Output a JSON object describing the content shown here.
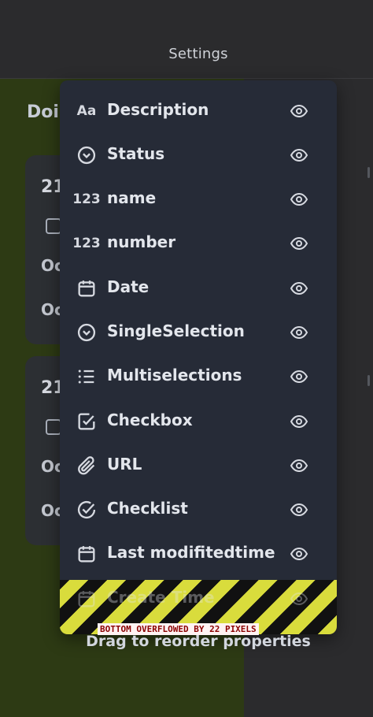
{
  "header": {
    "title": "Settings"
  },
  "board": {
    "column_title": "Doi",
    "cards": [
      {
        "number": "21",
        "line1": "Oc",
        "line2": "Oc"
      },
      {
        "number": "21",
        "line1": "Oc",
        "line2": "Oc"
      }
    ]
  },
  "properties": {
    "items": [
      {
        "label": "Description",
        "icon": "text-aa-icon",
        "icon_text": "Aa",
        "visible_icon": "eye-icon"
      },
      {
        "label": "Status",
        "icon": "chevron-circle-icon",
        "visible_icon": "eye-icon"
      },
      {
        "label": "name",
        "icon": "number-icon",
        "icon_text": "123",
        "visible_icon": "eye-icon"
      },
      {
        "label": "number",
        "icon": "number-icon",
        "icon_text": "123",
        "visible_icon": "eye-icon"
      },
      {
        "label": "Date",
        "icon": "calendar-icon",
        "visible_icon": "eye-icon"
      },
      {
        "label": "SingleSelection",
        "icon": "chevron-circle-icon",
        "visible_icon": "eye-icon"
      },
      {
        "label": "Multiselections",
        "icon": "list-icon",
        "visible_icon": "eye-icon"
      },
      {
        "label": "Checkbox",
        "icon": "checkbox-icon",
        "visible_icon": "eye-icon"
      },
      {
        "label": "URL",
        "icon": "paperclip-icon",
        "visible_icon": "eye-icon"
      },
      {
        "label": "Checklist",
        "icon": "check-circle-icon",
        "visible_icon": "eye-icon"
      },
      {
        "label": "Last modifitedtime",
        "icon": "calendar-icon",
        "visible_icon": "eye-icon"
      }
    ],
    "overflowed_item": {
      "label": "Create Time",
      "icon": "calendar-icon"
    },
    "overflow_message": "BOTTOM OVERFLOWED BY 22 PIXELS",
    "footer_hint": "Drag to reorder properties"
  },
  "colors": {
    "background": "#2b2b2d",
    "board": "#2d3a14",
    "popup": "#262b37",
    "stripe_yellow": "#d9dc3c",
    "stripe_black": "#111111",
    "overflow_text": "#8b0000"
  }
}
